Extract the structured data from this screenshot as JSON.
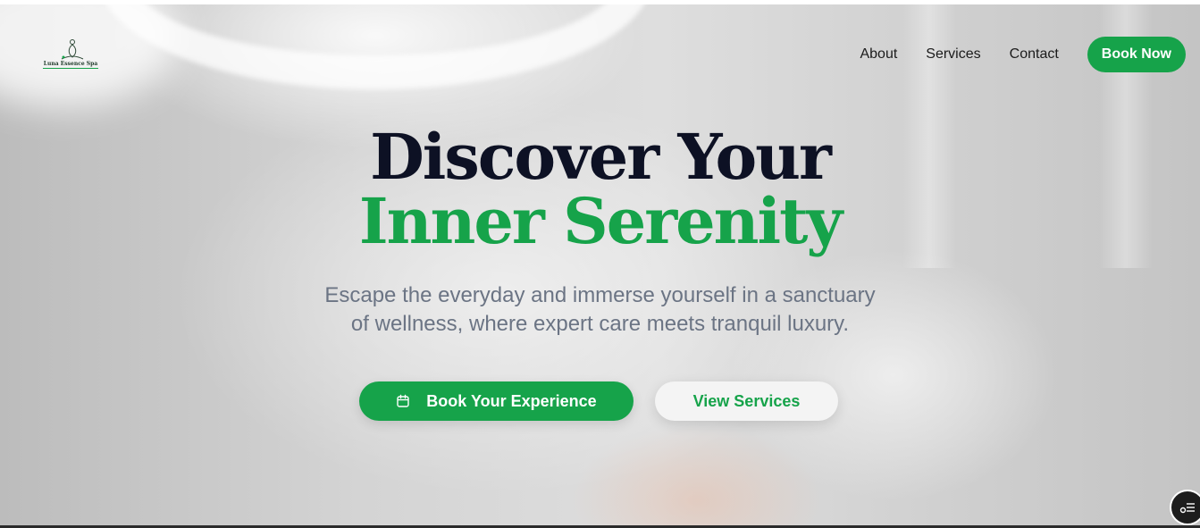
{
  "brand": {
    "name": "Luna Essence Spa",
    "accent_color": "#16a34a"
  },
  "nav": {
    "items": [
      {
        "label": "About"
      },
      {
        "label": "Services"
      },
      {
        "label": "Contact"
      }
    ],
    "cta_label": "Book Now"
  },
  "hero": {
    "headline_line1": "Discover Your",
    "headline_line2": "Inner Serenity",
    "subtitle_line1": "Escape the everyday and immerse yourself in a sanctuary",
    "subtitle_line2": "of wellness, where expert care meets tranquil luxury.",
    "primary_cta": {
      "label": "Book Your Experience",
      "icon": "calendar-icon"
    },
    "secondary_cta": {
      "label": "View Services"
    }
  },
  "widget": {
    "icon": "accessibility-menu-icon"
  }
}
